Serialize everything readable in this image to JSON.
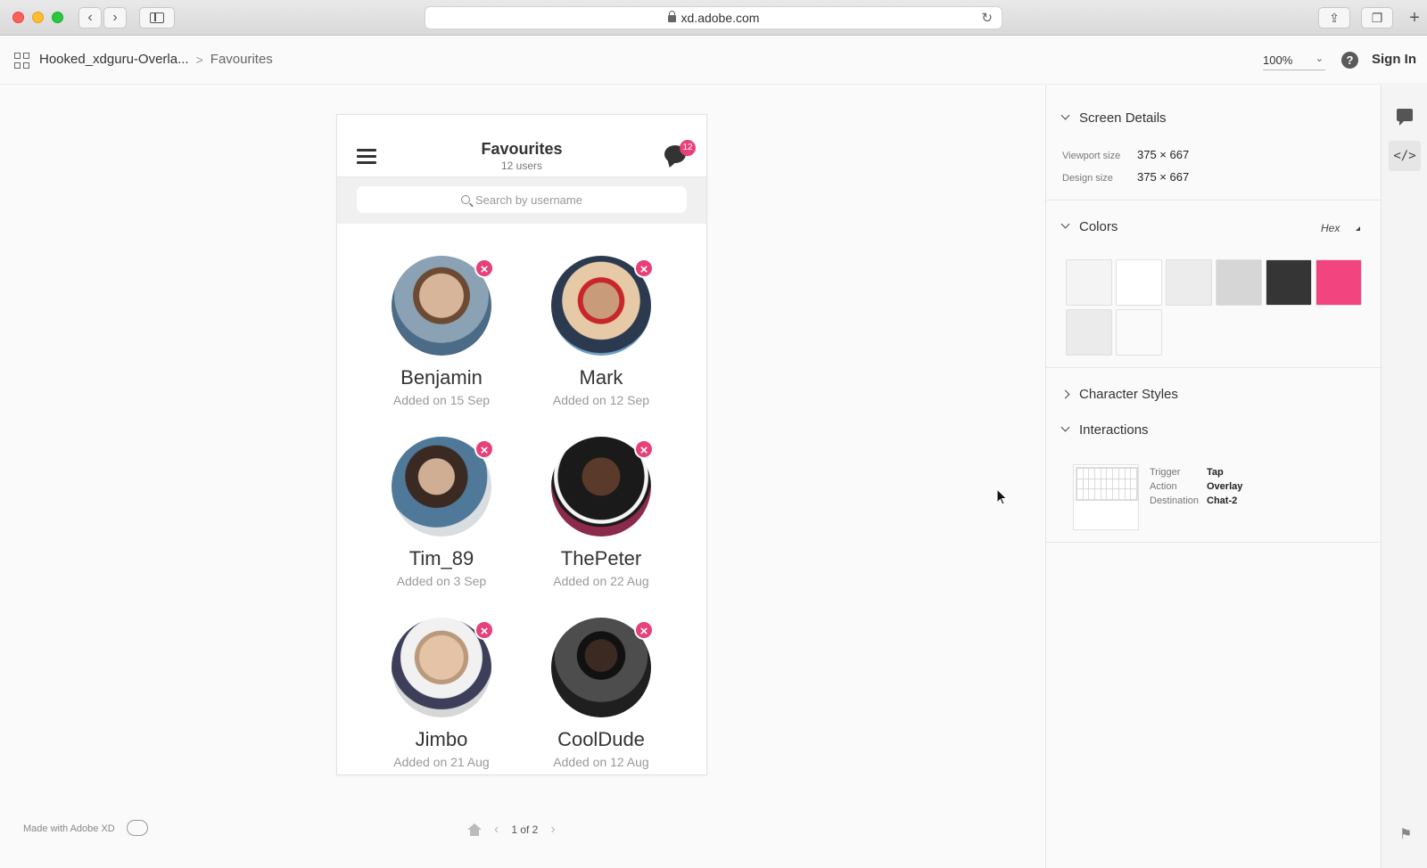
{
  "browser": {
    "url": "xd.adobe.com"
  },
  "appbar": {
    "project": "Hooked_xdguru-Overla...",
    "separator": ">",
    "screen": "Favourites",
    "zoom": "100%",
    "help": "?",
    "signin": "Sign In"
  },
  "artboard": {
    "title": "Favourites",
    "subtitle": "12 users",
    "chat_badge": "12",
    "search_placeholder": "Search by username",
    "users": [
      {
        "name": "Benjamin",
        "added": "Added on 15 Sep"
      },
      {
        "name": "Mark",
        "added": "Added on 12 Sep"
      },
      {
        "name": "Tim_89",
        "added": "Added on 3 Sep"
      },
      {
        "name": "ThePeter",
        "added": "Added on 22 Aug"
      },
      {
        "name": "Jimbo",
        "added": "Added on 21 Aug"
      },
      {
        "name": "CoolDude",
        "added": "Added on 12 Aug"
      }
    ],
    "remove_glyph": "×"
  },
  "footer": {
    "made_with": "Made with Adobe XD",
    "page": "1 of 2"
  },
  "panel": {
    "screen_details": {
      "title": "Screen Details",
      "viewport_label": "Viewport size",
      "viewport_value": "375 × 667",
      "design_label": "Design size",
      "design_value": "375 × 667"
    },
    "colors": {
      "title": "Colors",
      "format": "Hex",
      "swatches": [
        "#f4f4f4",
        "#ffffff",
        "#ececec",
        "#d6d6d6",
        "#353535",
        "#f2457f",
        "#ebebeb",
        "#fafafa"
      ]
    },
    "character_styles": {
      "title": "Character Styles"
    },
    "interactions": {
      "title": "Interactions",
      "trigger_label": "Trigger",
      "trigger_value": "Tap",
      "action_label": "Action",
      "action_value": "Overlay",
      "destination_label": "Destination",
      "destination_value": "Chat-2"
    }
  },
  "rail": {
    "code_icon": "</>"
  },
  "colors": {
    "accent": "#e8407a"
  }
}
